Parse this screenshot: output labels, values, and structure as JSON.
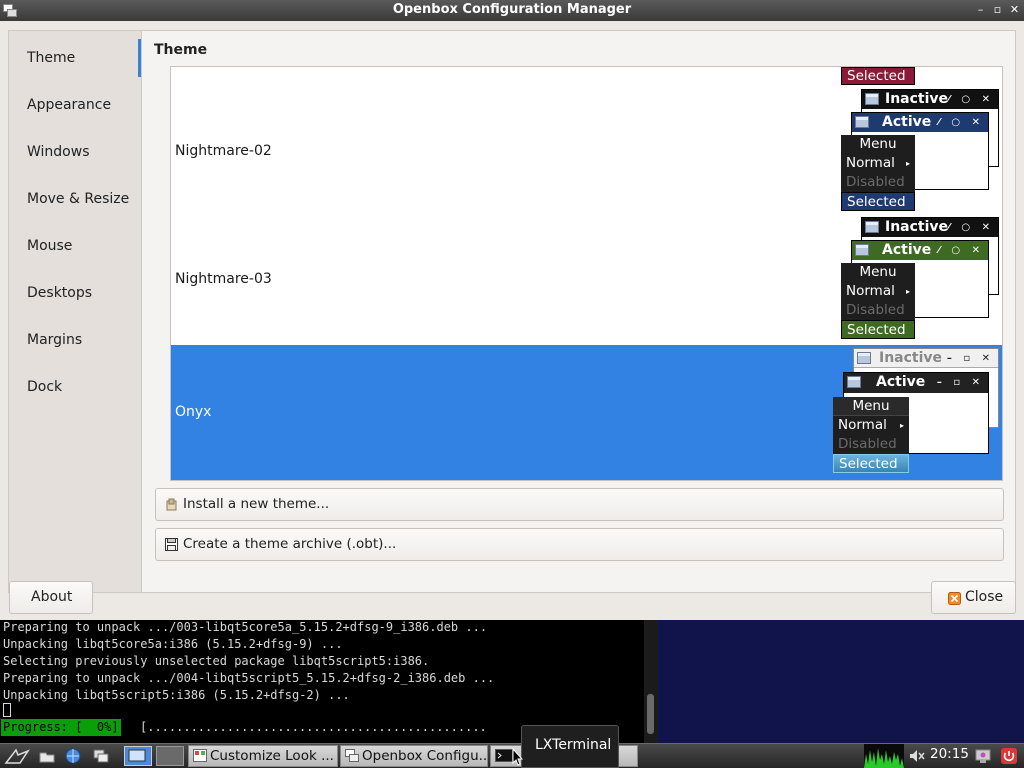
{
  "window": {
    "title": "Openbox Configuration Manager",
    "minimize_glyph": "–",
    "maximize_glyph": "▫",
    "close_glyph": "✕"
  },
  "sidebar": {
    "items": [
      {
        "label": "Theme"
      },
      {
        "label": "Appearance"
      },
      {
        "label": "Windows"
      },
      {
        "label": "Move & Resize"
      },
      {
        "label": "Mouse"
      },
      {
        "label": "Desktops"
      },
      {
        "label": "Margins"
      },
      {
        "label": "Dock"
      }
    ],
    "active_index": 0,
    "accent_color": "#3a82d8"
  },
  "content": {
    "heading": "Theme",
    "partial_preview": {
      "selected_label": "Selected",
      "selected_color": "#8a1a36"
    },
    "themes": [
      {
        "name": "Nightmare-02",
        "inactive_label": "Inactive",
        "active_label": "Active",
        "menu_title": "Menu",
        "normal_label": "Normal",
        "disabled_label": "Disabled",
        "selected_label": "Selected",
        "active_color": "#1f3a6e",
        "selected_color": "#1f3a6e"
      },
      {
        "name": "Nightmare-03",
        "inactive_label": "Inactive",
        "active_label": "Active",
        "menu_title": "Menu",
        "normal_label": "Normal",
        "disabled_label": "Disabled",
        "selected_label": "Selected",
        "active_color": "#3e6a22",
        "selected_color": "#3e6a22"
      },
      {
        "name": "Onyx",
        "inactive_label": "Inactive",
        "active_label": "Active",
        "menu_title": "Menu",
        "normal_label": "Normal",
        "disabled_label": "Disabled",
        "selected_label": "Selected",
        "active_color": "#222222",
        "selected_color": "#4a9ac8"
      }
    ],
    "selected_theme_index": 2,
    "selection_color": "#3182e3",
    "install_button": "Install a new theme...",
    "archive_button": "Create a theme archive (.obt)..."
  },
  "footer": {
    "about_button": "About",
    "close_button": "Close"
  },
  "terminal": {
    "lines": [
      "Preparing to unpack .../003-libqt5core5a_5.15.2+dfsg-9_i386.deb ...",
      "Unpacking libqt5core5a:i386 (5.15.2+dfsg-9) ...",
      "Selecting previously unselected package libqt5script5:i386.",
      "Preparing to unpack .../004-libqt5script5_5.15.2+dfsg-2_i386.deb ...",
      "Unpacking libqt5script5:i386 (5.15.2+dfsg-2) ..."
    ],
    "progress_label": "Progress: [  0%]",
    "progress_bar": "[..............................................."
  },
  "taskbar": {
    "tasks": [
      {
        "label": "Customize Look ..."
      },
      {
        "label": "Openbox Configu..."
      },
      {
        "label": ""
      }
    ],
    "clock": "20:15",
    "tooltip": "LXTerminal"
  }
}
